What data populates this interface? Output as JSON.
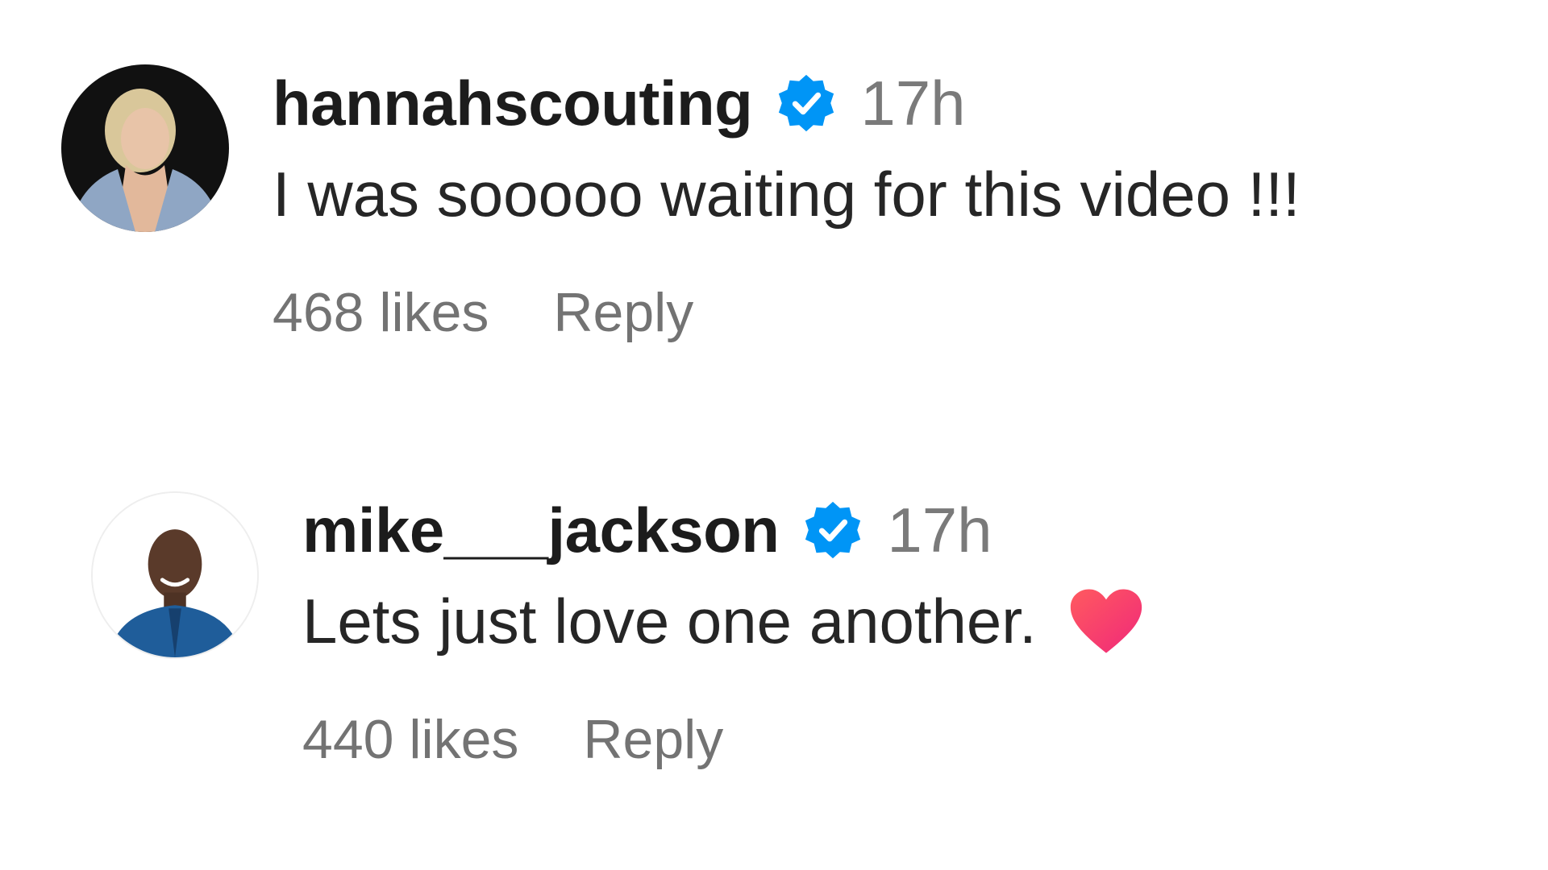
{
  "comments": [
    {
      "username": "hannahscouting",
      "verified_icon": "verified-badge-icon",
      "timestamp": "17h",
      "text": "I was sooooo waiting for this video !!!",
      "likes": "468 likes",
      "reply_label": "Reply"
    },
    {
      "username": "mike___jackson",
      "verified_icon": "verified-badge-icon",
      "timestamp": "17h",
      "text": "Lets just love one another.",
      "emoji": "red-heart-icon",
      "likes": "440 likes",
      "reply_label": "Reply"
    }
  ],
  "colors": {
    "verified_blue": "#0095f6",
    "muted_text": "#737373",
    "heart": "#ff3b6b"
  }
}
